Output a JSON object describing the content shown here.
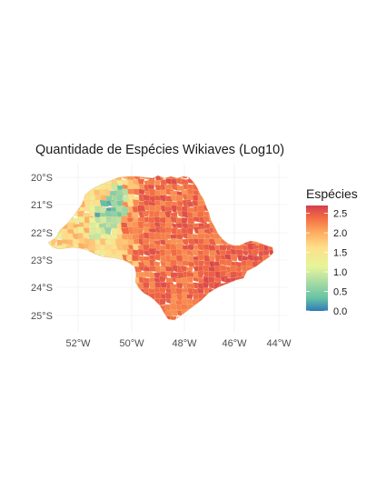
{
  "chart_data": {
    "type": "choropleth",
    "title": "Quantidade de Espécies Wikiaves (Log10)",
    "x_ticks": [
      "52°W",
      "50°W",
      "48°W",
      "46°W",
      "44°W"
    ],
    "y_ticks": [
      "20°S",
      "21°S",
      "22°S",
      "23°S",
      "24°S",
      "25°S"
    ],
    "x_tick_values": [
      -52,
      -50,
      -48,
      -46,
      -44
    ],
    "y_tick_values": [
      -20,
      -21,
      -22,
      -23,
      -24,
      -25
    ],
    "xlim": [
      -53.3,
      -43.7
    ],
    "ylim": [
      -25.4,
      -19.6
    ],
    "grid": true,
    "legend": {
      "title": "Espécies",
      "placement": "right",
      "labels": [
        "2.5",
        "2.0",
        "1.5",
        "1.0",
        "0.5",
        "0.0"
      ],
      "values": [
        2.5,
        2.0,
        1.5,
        1.0,
        0.5,
        0.0
      ],
      "range": [
        0.0,
        2.7
      ],
      "colors": [
        "#2f7ab8",
        "#66c2a5",
        "#abdda4",
        "#e6f598",
        "#fee08b",
        "#fdae61",
        "#f46d43",
        "#d53e4f"
      ]
    }
  }
}
